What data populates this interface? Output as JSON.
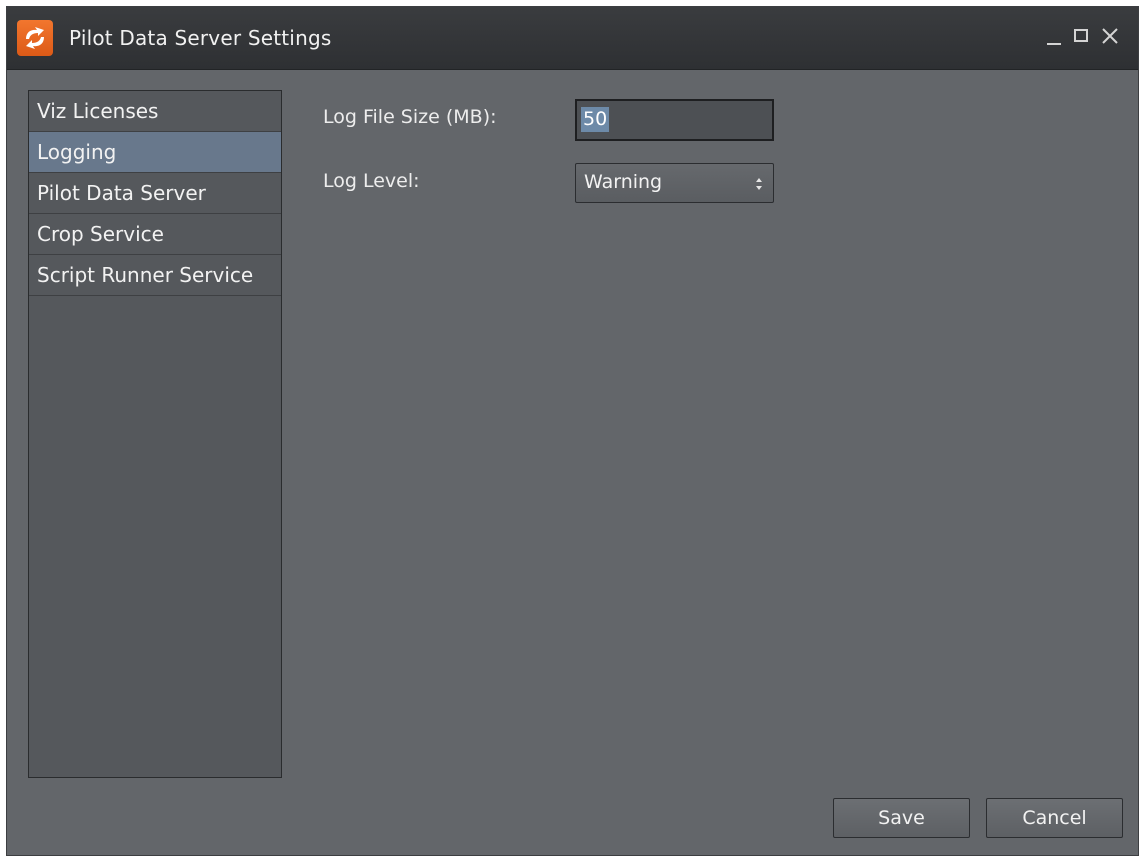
{
  "window": {
    "title": "Pilot Data Server Settings",
    "icon": "refresh-arrows-icon",
    "controls": [
      "minimize-icon",
      "maximize-icon",
      "close-icon"
    ]
  },
  "sidebar": {
    "items": [
      {
        "label": "Viz Licenses",
        "selected": false
      },
      {
        "label": "Logging",
        "selected": true
      },
      {
        "label": "Pilot Data Server",
        "selected": false
      },
      {
        "label": "Crop Service",
        "selected": false
      },
      {
        "label": "Script Runner Service",
        "selected": false
      }
    ]
  },
  "form": {
    "log_file_size": {
      "label": "Log File Size (MB):",
      "value": "50"
    },
    "log_level": {
      "label": "Log Level:",
      "value": "Warning"
    }
  },
  "buttons": {
    "save": "Save",
    "cancel": "Cancel"
  },
  "colors": {
    "accent_icon": "#e8662a",
    "selection": "#68788c",
    "background": "#63666a"
  }
}
